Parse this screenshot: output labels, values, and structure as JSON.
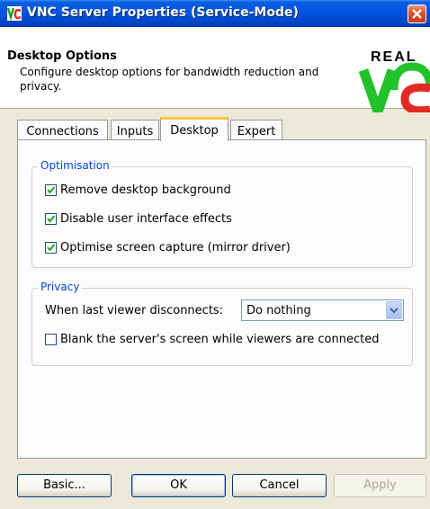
{
  "window": {
    "title": "VNC Server Properties (Service-Mode)",
    "icon": "vnc-icon"
  },
  "header": {
    "title": "Desktop Options",
    "description": "Configure desktop options for bandwidth reduction and privacy.",
    "logo_text": "REAL"
  },
  "tabs": [
    {
      "label": "Connections",
      "active": false
    },
    {
      "label": "Inputs",
      "active": false
    },
    {
      "label": "Desktop",
      "active": true
    },
    {
      "label": "Expert",
      "active": false
    }
  ],
  "optimisation": {
    "title": "Optimisation",
    "options": [
      {
        "label": "Remove desktop background",
        "checked": true
      },
      {
        "label": "Disable user interface effects",
        "checked": true
      },
      {
        "label": "Optimise screen capture (mirror driver)",
        "checked": true
      }
    ]
  },
  "privacy": {
    "title": "Privacy",
    "disconnect_label": "When last viewer disconnects:",
    "disconnect_value": "Do nothing",
    "blank_label": "Blank the server's screen while viewers are connected",
    "blank_checked": false
  },
  "buttons": {
    "basic": "Basic...",
    "ok": "OK",
    "cancel": "Cancel",
    "apply": "Apply"
  },
  "colors": {
    "titlebar": "#0054E3",
    "group_title": "#0046D5",
    "logo_green": "#22C32A",
    "logo_red": "#E32A22"
  }
}
